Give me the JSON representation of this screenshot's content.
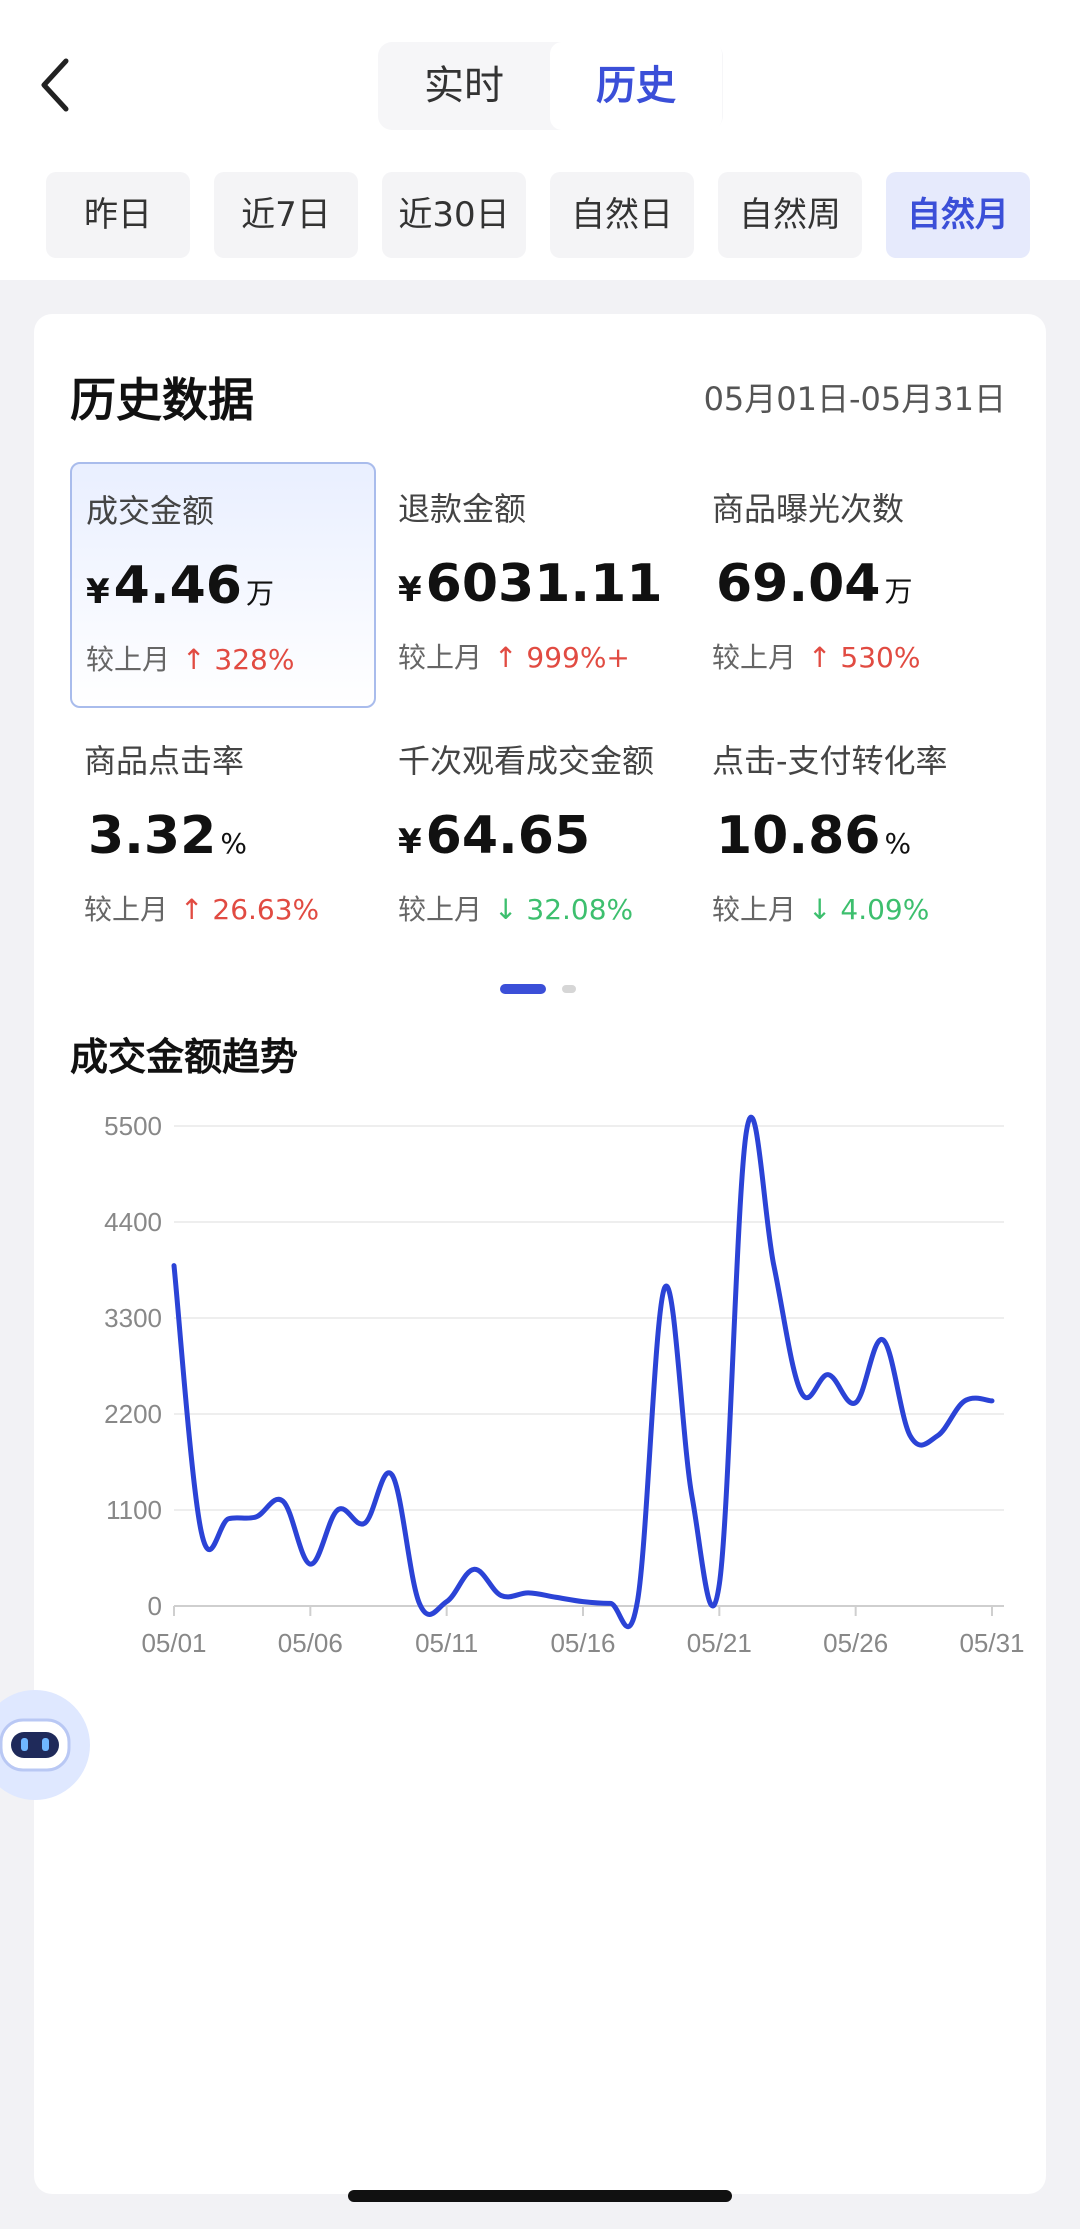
{
  "header": {
    "back_icon": "chevron-left-icon",
    "mode_tabs": [
      "实时",
      "历史"
    ],
    "active_mode": "历史"
  },
  "ranges": [
    "昨日",
    "近7日",
    "近30日",
    "自然日",
    "自然周",
    "自然月"
  ],
  "active_range": "自然月",
  "card": {
    "title": "历史数据",
    "date_range": "05月01日-05月31日"
  },
  "metrics": [
    {
      "label": "成交金额",
      "currency": "¥",
      "value": "4.46",
      "unit": "万",
      "compare_label": "较上月",
      "delta": "↑ 328%",
      "direction": "up"
    },
    {
      "label": "退款金额",
      "currency": "¥",
      "value": "6031.11",
      "unit": "",
      "compare_label": "较上月",
      "delta": "↑ 999%+",
      "direction": "up"
    },
    {
      "label": "商品曝光次数",
      "currency": "",
      "value": "69.04",
      "unit": "万",
      "compare_label": "较上月",
      "delta": "↑ 530%",
      "direction": "up"
    },
    {
      "label": "商品点击率",
      "currency": "",
      "value": "3.32",
      "unit": "%",
      "compare_label": "较上月",
      "delta": "↑ 26.63%",
      "direction": "up"
    },
    {
      "label": "千次观看成交金额",
      "currency": "¥",
      "value": "64.65",
      "unit": "",
      "compare_label": "较上月",
      "delta": "↓ 32.08%",
      "direction": "down"
    },
    {
      "label": "点击-支付转化率",
      "currency": "",
      "value": "10.86",
      "unit": "%",
      "compare_label": "较上月",
      "delta": "↓ 4.09%",
      "direction": "down"
    }
  ],
  "pager": {
    "pages": 2,
    "active": 1
  },
  "trend": {
    "title": "成交金额趋势"
  },
  "chart_data": {
    "type": "line",
    "title": "成交金额趋势",
    "x_tick_labels": [
      "05/01",
      "05/06",
      "05/11",
      "05/16",
      "05/21",
      "05/26",
      "05/31"
    ],
    "y_tick_labels": [
      "0",
      "1100",
      "2200",
      "3300",
      "4400",
      "5500"
    ],
    "ylim": [
      0,
      5500
    ],
    "grid": true,
    "series": [
      {
        "color": "#2b43d6",
        "x": [
          "05/01",
          "05/02",
          "05/03",
          "05/04",
          "05/05",
          "05/06",
          "05/07",
          "05/08",
          "05/09",
          "05/10",
          "05/11",
          "05/12",
          "05/13",
          "05/14",
          "05/15",
          "05/16",
          "05/17",
          "05/18",
          "05/19",
          "05/20",
          "05/21",
          "05/22",
          "05/23",
          "05/24",
          "05/25",
          "05/26",
          "05/27",
          "05/28",
          "05/29",
          "05/30",
          "05/31"
        ],
        "values": [
          3900,
          850,
          1000,
          1020,
          1200,
          480,
          1100,
          950,
          1500,
          30,
          50,
          420,
          120,
          150,
          100,
          50,
          30,
          60,
          3650,
          1250,
          250,
          5450,
          3900,
          2450,
          2650,
          2330,
          3050,
          1950,
          1950,
          2350,
          2350
        ]
      }
    ]
  },
  "floating": {
    "assistant_icon": "robot-assistant-icon"
  }
}
